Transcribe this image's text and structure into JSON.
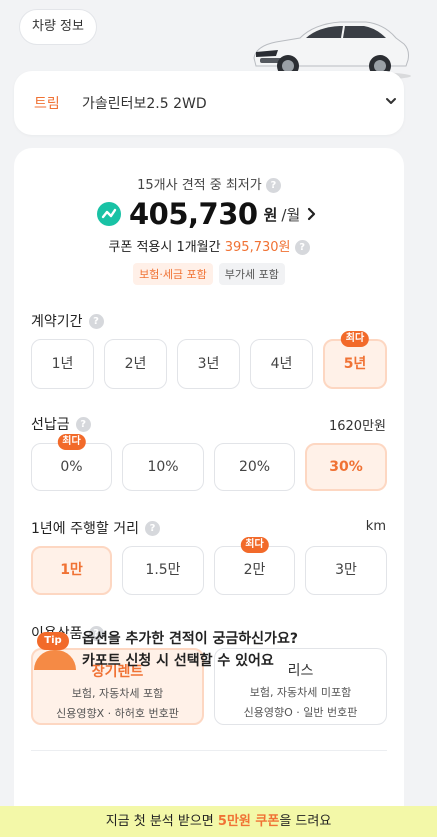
{
  "header": {
    "vehicle_info_label": "차량 정보"
  },
  "trim": {
    "label": "트림",
    "value": "가솔린터보2.5 2WD"
  },
  "quote": {
    "subtitle": "15개사 견적 중 최저가",
    "price": "405,730",
    "unit_won": "원",
    "unit_month": "/월",
    "coupon_prefix": "쿠폰 적용시 1개월간",
    "coupon_amount": "395,730원",
    "tags": [
      "보험·세금 포함",
      "부가세 포함"
    ]
  },
  "contract": {
    "title": "계약기간",
    "options": [
      "1년",
      "2년",
      "3년",
      "4년",
      "5년"
    ],
    "selected": "5년",
    "badge_label": "최다"
  },
  "deposit": {
    "title": "선납금",
    "right_value": "1620만원",
    "options": [
      "0%",
      "10%",
      "20%",
      "30%"
    ],
    "selected": "30%",
    "badge_label": "최다"
  },
  "mileage": {
    "title": "1년에 주행할 거리",
    "right_unit": "km",
    "options": [
      "1만",
      "1.5만",
      "2만",
      "3만"
    ],
    "selected": "1만",
    "badge_label": "최다"
  },
  "product": {
    "title": "이용상품",
    "options": [
      {
        "title": "장기렌트",
        "line1": "보험, 자동차세 포함",
        "line2": "신용영향X · 하허호 번호판"
      },
      {
        "title": "리스",
        "line1": "보험, 자동차세 미포함",
        "line2": "신용영향O · 일반 번호판"
      }
    ],
    "selected": "장기렌트"
  },
  "tip": {
    "badge": "Tip",
    "line1": "옵션을 추가한 견적이 궁금하신가요?",
    "line2": "카포트 신청 시 선택할 수 있어요"
  },
  "banner": {
    "prefix": "지금 첫 분석 받으면",
    "highlight": "5만원 쿠폰",
    "suffix": "을 드려요"
  },
  "colors": {
    "accent": "#f07234",
    "badge": "#f26a2a",
    "teal": "#19c2a5",
    "banner_bg": "#f3f8a8"
  }
}
